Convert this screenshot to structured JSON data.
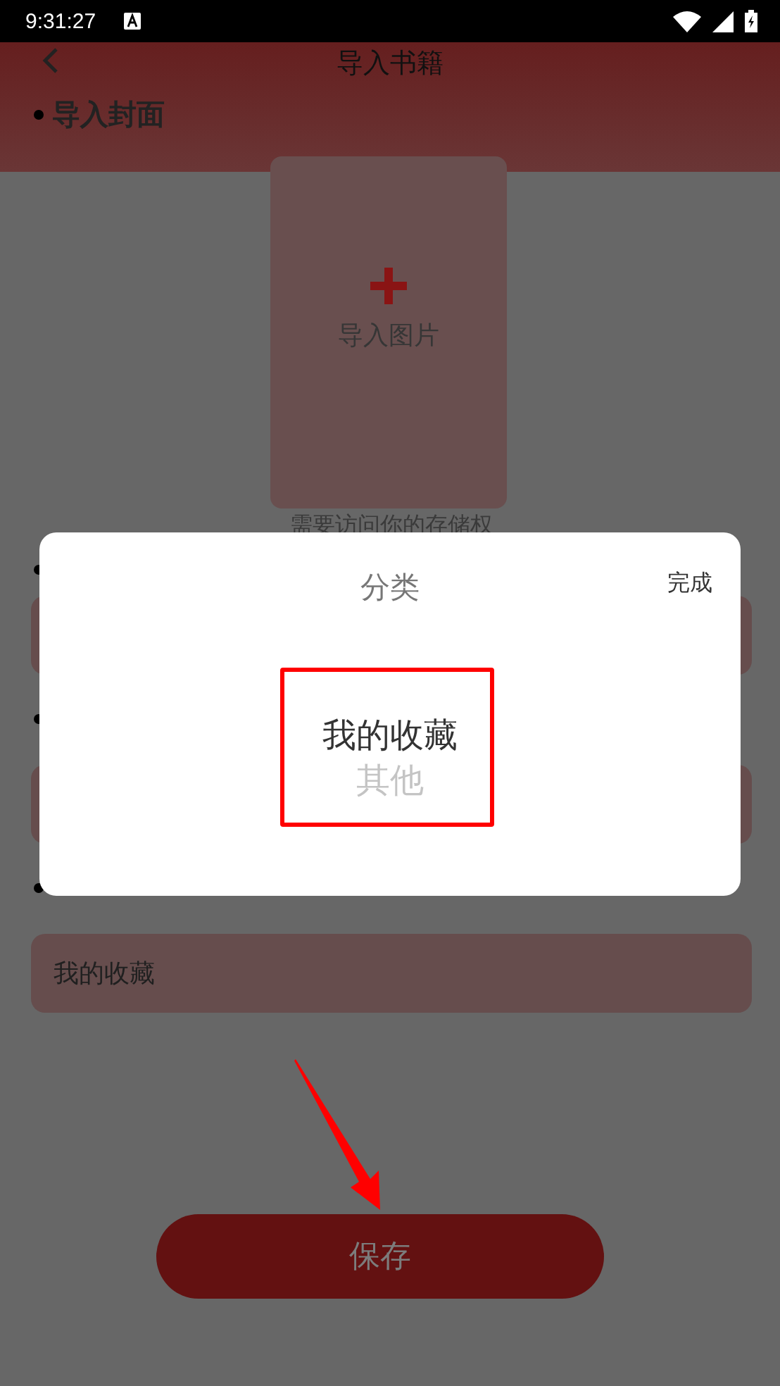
{
  "status_bar": {
    "time": "9:31:27"
  },
  "header": {
    "title": "导入书籍"
  },
  "cover": {
    "label": "导入封面",
    "button_label": "导入图片",
    "hint": "需要访问你的存储权"
  },
  "category_field": {
    "value": "我的收藏"
  },
  "dialog": {
    "title": "分类",
    "done": "完成",
    "options": [
      {
        "label": "我的收藏",
        "selected": true
      },
      {
        "label": "其他",
        "selected": false
      }
    ]
  },
  "save_button": {
    "label": "保存"
  }
}
